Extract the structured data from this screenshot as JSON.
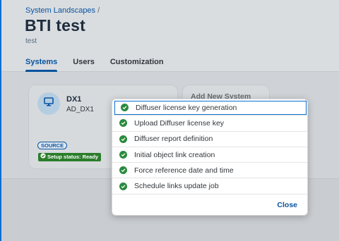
{
  "breadcrumb": {
    "link": "System Landscapes",
    "separator": "/"
  },
  "page": {
    "title": "BTI test",
    "subtitle": "test"
  },
  "tabs": [
    {
      "label": "Systems",
      "active": true
    },
    {
      "label": "Users",
      "active": false
    },
    {
      "label": "Customization",
      "active": false
    }
  ],
  "system_card": {
    "icon": "monitor-icon",
    "name": "DX1",
    "id": "AD_DX1",
    "source_badge": "SOURCE",
    "status_label": "Setup status: Ready"
  },
  "add_card": {
    "label": "Add New System"
  },
  "setup_popover": {
    "steps": [
      {
        "label": "Diffuser license key generation",
        "status": "done",
        "focused": true
      },
      {
        "label": "Upload Diffuser license key",
        "status": "done"
      },
      {
        "label": "Diffuser report definition",
        "status": "done"
      },
      {
        "label": "Initial object link creation",
        "status": "done"
      },
      {
        "label": "Force reference date and time",
        "status": "done"
      },
      {
        "label": "Schedule links update job",
        "status": "done"
      }
    ],
    "close_label": "Close"
  },
  "colors": {
    "accent": "#0854a0",
    "success": "#2b8a3e",
    "status_badge": "#2b7d2b"
  }
}
